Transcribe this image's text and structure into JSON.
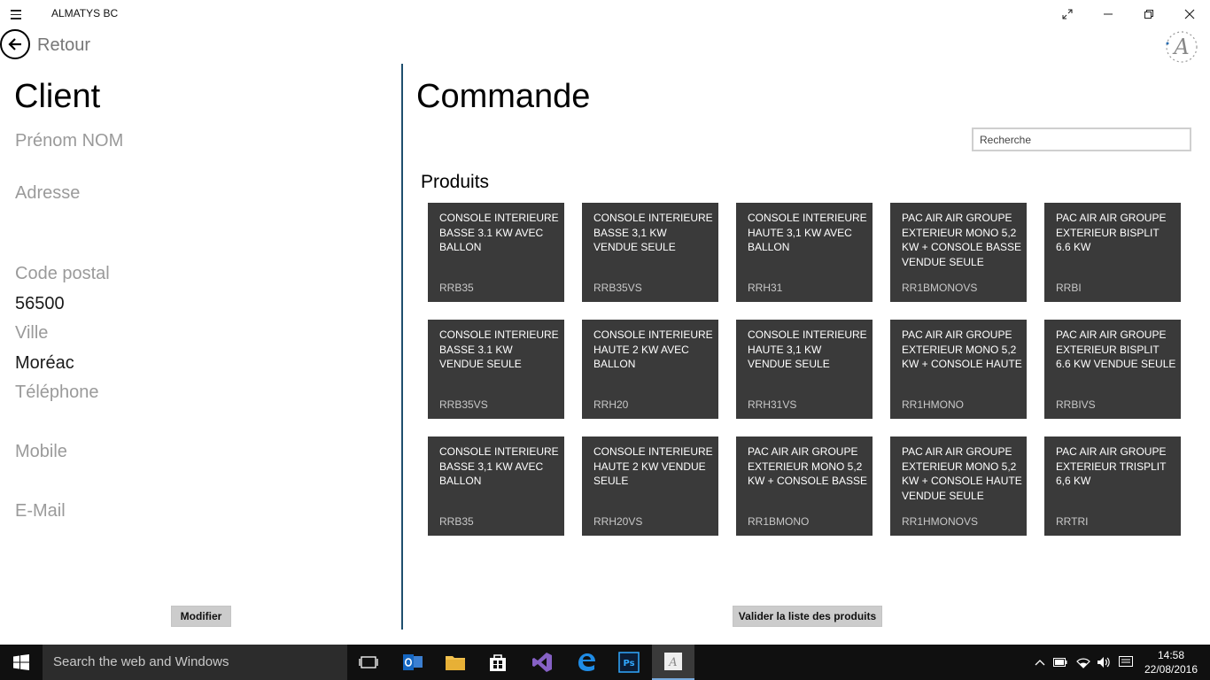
{
  "window": {
    "title": "ALMATYS BC"
  },
  "nav": {
    "back_label": "Retour"
  },
  "client": {
    "heading": "Client",
    "name_placeholder": "Prénom NOM",
    "address_label": "Adresse",
    "postal_label": "Code postal",
    "postal_value": "56500",
    "city_label": "Ville",
    "city_value": "Moréac",
    "phone_label": "Téléphone",
    "mobile_label": "Mobile",
    "email_label": "E-Mail",
    "modify_button": "Modifier"
  },
  "order": {
    "heading": "Commande",
    "search_placeholder": "Recherche",
    "products_heading": "Produits",
    "validate_button": "Valider la liste des produits",
    "products": [
      {
        "name": "CONSOLE INTERIEURE BASSE 3.1 KW AVEC BALLON",
        "code": "RRB35"
      },
      {
        "name": "CONSOLE INTERIEURE BASSE 3,1 KW VENDUE SEULE",
        "code": "RRB35VS"
      },
      {
        "name": "CONSOLE INTERIEURE HAUTE 3,1 KW AVEC BALLON",
        "code": "RRH31"
      },
      {
        "name": "PAC AIR AIR GROUPE EXTERIEUR MONO 5,2 KW + CONSOLE BASSE VENDUE SEULE",
        "code": "RR1BMONOVS"
      },
      {
        "name": "PAC AIR AIR GROUPE EXTERIEUR BISPLIT 6.6 KW",
        "code": "RRBI"
      },
      {
        "name": "CONSOLE INTERIEURE BASSE 3.1 KW VENDUE SEULE",
        "code": "RRB35VS"
      },
      {
        "name": "CONSOLE INTERIEURE HAUTE 2 KW AVEC BALLON",
        "code": "RRH20"
      },
      {
        "name": "CONSOLE INTERIEURE HAUTE 3,1 KW VENDUE SEULE",
        "code": "RRH31VS"
      },
      {
        "name": "PAC AIR AIR GROUPE EXTERIEUR MONO 5,2 KW + CONSOLE HAUTE",
        "code": "RR1HMONO"
      },
      {
        "name": "PAC AIR AIR GROUPE EXTERIEUR BISPLIT 6.6 KW VENDUE SEULE",
        "code": "RRBIVS"
      },
      {
        "name": "CONSOLE INTERIEURE BASSE 3,1 KW AVEC BALLON",
        "code": "RRB35"
      },
      {
        "name": "CONSOLE INTERIEURE HAUTE 2 KW VENDUE SEULE",
        "code": "RRH20VS"
      },
      {
        "name": "PAC AIR AIR GROUPE EXTERIEUR MONO 5,2 KW + CONSOLE BASSE",
        "code": "RR1BMONO"
      },
      {
        "name": "PAC AIR AIR GROUPE EXTERIEUR MONO 5,2 KW + CONSOLE HAUTE VENDUE SEULE",
        "code": "RR1HMONOVS"
      },
      {
        "name": "PAC AIR AIR GROUPE EXTERIEUR TRISPLIT 6,6 KW",
        "code": "RRTRI"
      }
    ]
  },
  "taskbar": {
    "search_placeholder": "Search the web and Windows",
    "time": "14:58",
    "date": "22/08/2016",
    "apps": [
      "task-view-icon",
      "outlook-icon",
      "file-explorer-icon",
      "store-icon",
      "visual-studio-icon",
      "edge-icon",
      "photoshop-icon",
      "almatys-app-icon"
    ]
  },
  "colors": {
    "tile_bg": "#3a3a3a",
    "divider": "#1f4f6e",
    "button_bg": "#cccccc",
    "taskbar_bg": "#101010"
  }
}
